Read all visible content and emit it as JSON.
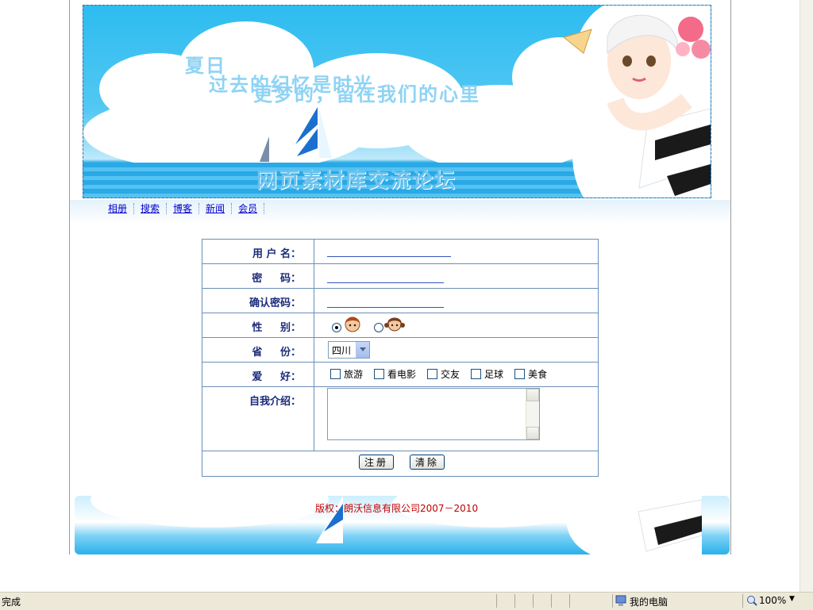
{
  "banner": {
    "text_line1": "夏日",
    "text_line2": "过去的纪忆是时光",
    "text_line3": "更梦的，留在我们的心里",
    "text_bottom": "网页素材库交流论坛"
  },
  "nav": {
    "items": [
      "相册",
      "搜索",
      "博客",
      "新闻",
      "会员"
    ]
  },
  "form": {
    "username_label": "用 户 名：",
    "password_label": "密     码：",
    "confirm_label": "确认密码：",
    "gender_label": "性     别：",
    "province_label": "省     份：",
    "province_value": "四川",
    "hobby_label": "爱     好：",
    "hobbies": [
      "旅游",
      "看电影",
      "交友",
      "足球",
      "美食"
    ],
    "intro_label": "自我介绍：",
    "submit_label": "注册",
    "clear_label": "清除"
  },
  "footer": {
    "copyright": "版权：朗沃信息有限公司2007－2010"
  },
  "statusbar": {
    "status_text": "完成",
    "zone_text": "我的电脑",
    "zoom_text": "100%"
  }
}
